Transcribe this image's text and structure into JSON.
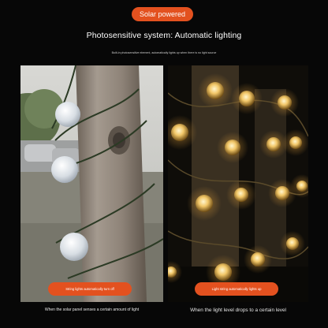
{
  "badge": "Solar powered",
  "headline": "Photosensitive system: Automatic lighting",
  "subline": "Built-in photosensitive element, automatically lights up when there is no light source",
  "left_panel": {
    "pill": "String lights automatically turn off",
    "caption": "When the solar panel senses a certain amount of light"
  },
  "right_panel": {
    "pill": "Light string automatically lights up",
    "caption": "When the light level drops to a certain level"
  },
  "colors": {
    "accent": "#e3511f",
    "background": "#070707"
  }
}
